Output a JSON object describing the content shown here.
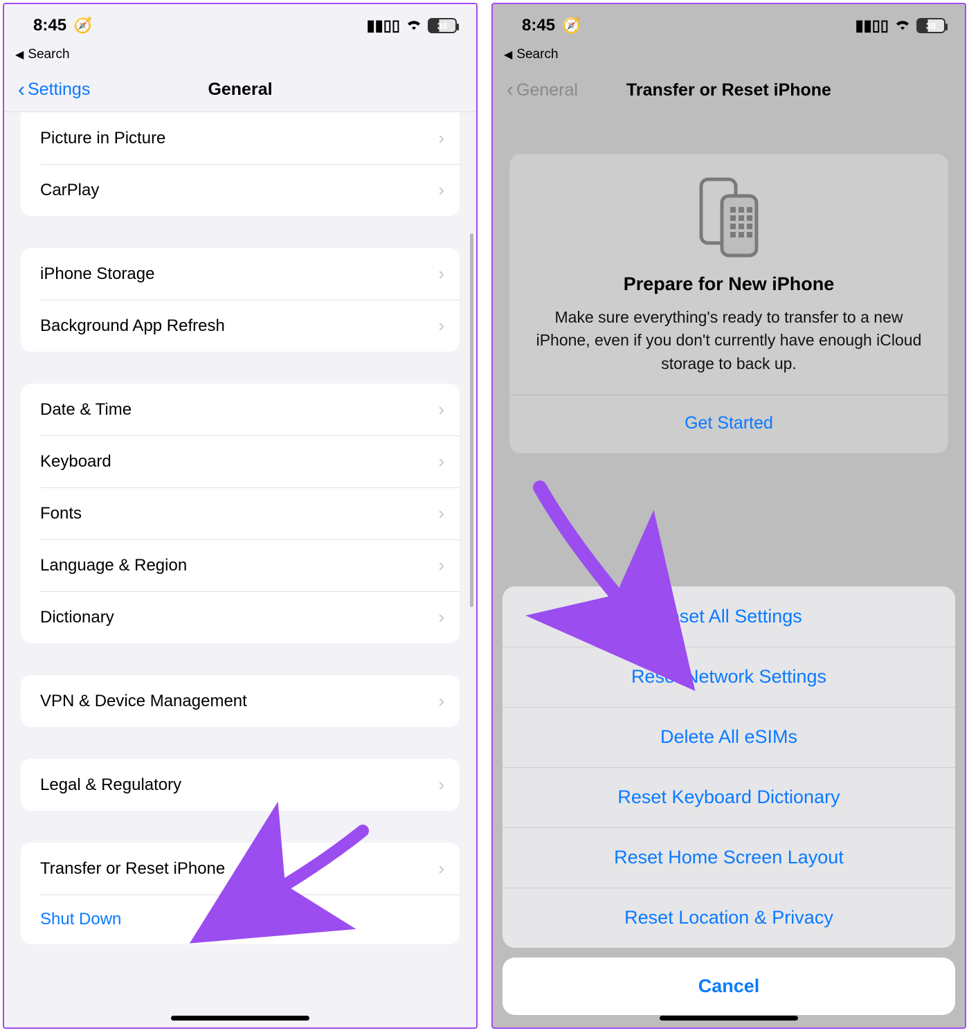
{
  "status": {
    "time": "8:45",
    "battery_pct": "38",
    "crumb_label": "Search"
  },
  "left": {
    "back_label": "Settings",
    "title": "General",
    "group1": [
      "Picture in Picture",
      "CarPlay"
    ],
    "group2": [
      "iPhone Storage",
      "Background App Refresh"
    ],
    "group3": [
      "Date & Time",
      "Keyboard",
      "Fonts",
      "Language & Region",
      "Dictionary"
    ],
    "group4": [
      "VPN & Device Management"
    ],
    "group5": [
      "Legal & Regulatory"
    ],
    "group6": {
      "transfer": "Transfer or Reset iPhone",
      "shutdown": "Shut Down"
    }
  },
  "right": {
    "back_label": "General",
    "title": "Transfer or Reset iPhone",
    "card": {
      "heading": "Prepare for New iPhone",
      "body": "Make sure everything's ready to transfer to a new iPhone, even if you don't currently have enough iCloud storage to back up.",
      "action": "Get Started"
    },
    "sheet": [
      "Reset All Settings",
      "Reset Network Settings",
      "Delete All eSIMs",
      "Reset Keyboard Dictionary",
      "Reset Home Screen Layout",
      "Reset Location & Privacy"
    ],
    "cancel": "Cancel"
  }
}
